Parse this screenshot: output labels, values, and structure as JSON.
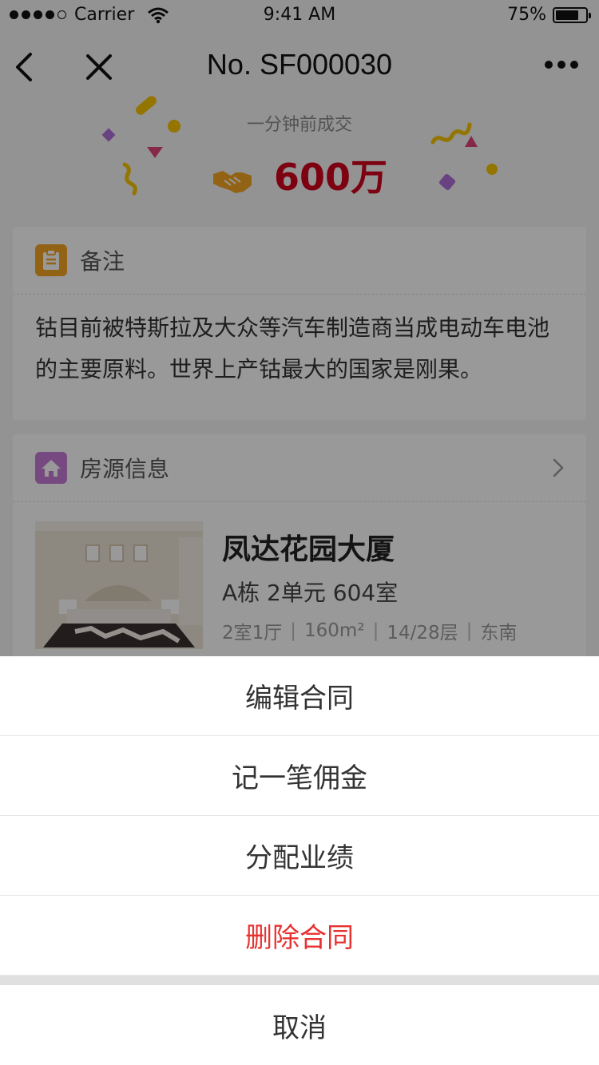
{
  "status_bar": {
    "carrier": "Carrier",
    "time": "9:41 AM",
    "battery": "75%"
  },
  "nav": {
    "title": "No. SF000030"
  },
  "deal": {
    "subtitle": "一分钟前成交",
    "amount": "600万"
  },
  "note_card": {
    "title": "备注",
    "text": "钴目前被特斯拉及大众等汽车制造商当成电动车电池的主要原料。世界上产钴最大的国家是刚果。"
  },
  "property_card": {
    "title": "房源信息",
    "name": "凤达花园大厦",
    "unit": "A栋  2单元  604室",
    "meta": [
      "2室1厅",
      "160m²",
      "14/28层",
      "东南"
    ]
  },
  "action_sheet": {
    "items": [
      "编辑合同",
      "记一笔佣金",
      "分配业绩",
      "删除合同"
    ],
    "cancel": "取消"
  },
  "colors": {
    "accent_red": "#e63331",
    "amount_red": "#d0021b",
    "note_icon": "#f5a623",
    "home_icon": "#c57bd6"
  }
}
